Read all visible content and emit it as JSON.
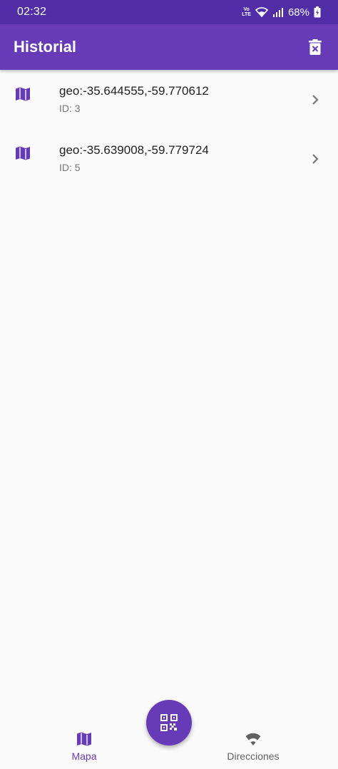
{
  "status_bar": {
    "time": "02:32",
    "volte_line1": "Vo",
    "volte_line2": "LTE",
    "battery_percent": "68%"
  },
  "appbar": {
    "title": "Historial",
    "delete_icon": "delete-forever-icon"
  },
  "items": [
    {
      "title": "geo:-35.644555,-59.770612",
      "subtitle": "ID: 3",
      "icon": "map-icon"
    },
    {
      "title": "geo:-35.639008,-59.779724",
      "subtitle": "ID: 5",
      "icon": "map-icon"
    }
  ],
  "bottom_nav": {
    "items": [
      {
        "label": "Mapa",
        "icon": "map-icon",
        "active": true
      },
      {
        "label": "Direcciones",
        "icon": "wifi-icon",
        "active": false
      }
    ]
  },
  "fab": {
    "icon": "qr-scan-icon"
  },
  "colors": {
    "primary": "#673ab7",
    "primary_dark": "#512da8",
    "background": "#fafafa",
    "inactive": "#616161"
  }
}
